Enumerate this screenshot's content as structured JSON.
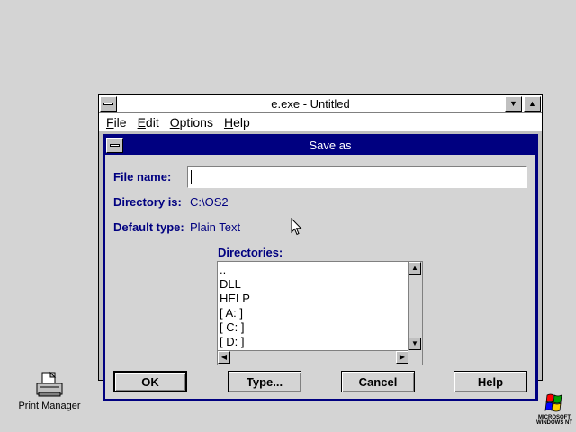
{
  "desktop": {
    "icons": [
      {
        "label": "Print Manager",
        "icon": "printer-icon"
      },
      {
        "label": "",
        "icon": "microsoft-windows-nt-logo",
        "caption_lines": [
          "MICROSOFT",
          "WINDOWS NT"
        ]
      }
    ]
  },
  "app_window": {
    "title": "e.exe - Untitled",
    "menu": [
      {
        "label": "File",
        "mnemonic": "F",
        "rest": "ile"
      },
      {
        "label": "Edit",
        "mnemonic": "E",
        "rest": "dit"
      },
      {
        "label": "Options",
        "mnemonic": "O",
        "rest": "ptions"
      },
      {
        "label": "Help",
        "mnemonic": "H",
        "rest": "elp"
      }
    ],
    "controls": {
      "minimize": "▼",
      "maximize": "▲"
    }
  },
  "save_dialog": {
    "title": "Save as",
    "file_name_label": "File name:",
    "file_name_value": "",
    "directory_label": "Directory is:",
    "directory_value": "C:\\OS2",
    "default_type_label": "Default type:",
    "default_type_value": "Plain Text",
    "directories_label": "Directories:",
    "directories": [
      "..",
      "DLL",
      "HELP",
      "[ A: ]",
      "[ C: ]",
      "[ D: ]"
    ],
    "scroll": {
      "up": "▲",
      "down": "▼",
      "left": "◀",
      "right": "▶"
    },
    "buttons": {
      "ok": "OK",
      "type": "Type...",
      "cancel": "Cancel",
      "help": "Help"
    }
  },
  "colors": {
    "desktop_bg": "#d4d4d4",
    "dialog_frame": "#000080",
    "label_text": "#000080"
  }
}
